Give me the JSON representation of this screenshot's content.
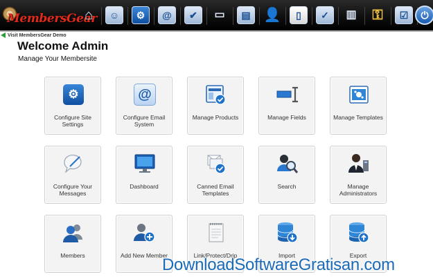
{
  "app": {
    "logo_text": "MembersGear"
  },
  "back_link": "Visit MembersGear Demo",
  "page": {
    "title": "Welcome Admin",
    "subtitle": "Manage Your Membersite"
  },
  "nav_icons": [
    "home-icon",
    "members-check-icon",
    "settings-gear-icon",
    "email-at-icon",
    "products-check-icon",
    "fields-icon",
    "templates-icon",
    "user-icon",
    "document-icon",
    "protect-icon",
    "stats-icon",
    "key-user-icon",
    "clipboard-check-icon",
    "power-icon"
  ],
  "cards": [
    {
      "label": "Configure Site Settings",
      "icon": "gear-icon"
    },
    {
      "label": "Configure Email System",
      "icon": "at-sign-icon"
    },
    {
      "label": "Manage Products",
      "icon": "product-window-check-icon"
    },
    {
      "label": "Manage Fields",
      "icon": "text-field-cursor-icon"
    },
    {
      "label": "Manage Templates",
      "icon": "template-sparkle-icon"
    },
    {
      "label": "Configure Your Messages",
      "icon": "speech-bubble-pen-icon"
    },
    {
      "label": "Dashboard",
      "icon": "monitor-icon"
    },
    {
      "label": "Canned Email Templates",
      "icon": "email-template-check-icon"
    },
    {
      "label": "Search",
      "icon": "user-search-icon"
    },
    {
      "label": "Manage Administrators",
      "icon": "admin-user-icon"
    },
    {
      "label": "Members",
      "icon": "users-group-icon"
    },
    {
      "label": "Add New Member",
      "icon": "add-user-icon"
    },
    {
      "label": "Link/Protect/Drip",
      "icon": "notepad-icon"
    },
    {
      "label": "Import",
      "icon": "database-import-icon"
    },
    {
      "label": "Export",
      "icon": "database-export-icon"
    }
  ],
  "watermark": "DownloadSoftwareGratisan.com"
}
